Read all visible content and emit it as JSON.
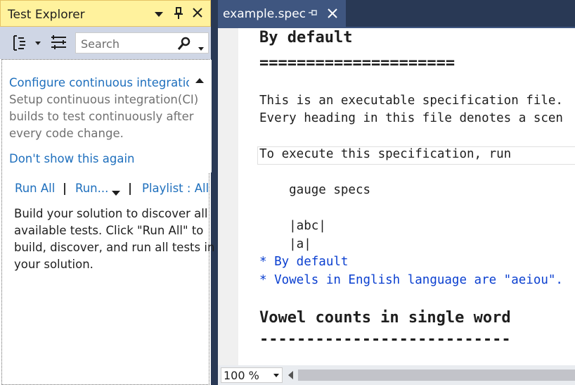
{
  "test_explorer": {
    "title": "Test Explorer",
    "search_placeholder": "Search",
    "notice": {
      "title": "Configure continuous integratio",
      "lines": [
        "Setup continuous integration(CI)",
        "builds to test continuously after",
        "every code change."
      ],
      "dismiss": "Don't show this again"
    },
    "run_all": "Run All",
    "run": "Run...",
    "playlist": "Playlist : All",
    "separator": "|",
    "message_lines": [
      "Build your solution to discover all",
      "available tests. Click \"Run All\" to",
      "build, discover, and run all tests in",
      "your solution."
    ]
  },
  "editor": {
    "tab_label": "example.spec",
    "zoom": "100 %",
    "lines": [
      "By default",
      "=====================",
      "This is an executable specification file.",
      "Every heading in this file denotes a scen",
      "To execute this specification, run",
      "    gauge specs",
      "    |abc|",
      "    |a|",
      "* By default",
      "* Vowels in English language are \"aeiou\".",
      "Vowel counts in single word",
      "---------------------------"
    ]
  }
}
